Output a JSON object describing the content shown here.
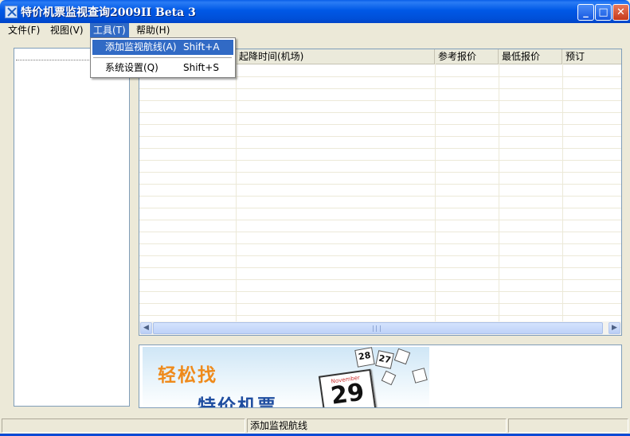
{
  "window": {
    "title": "特价机票监视查询2009II Beta 3",
    "controls": {
      "minimize": "_",
      "maximize": "□",
      "close": "✕"
    }
  },
  "menubar": {
    "items": [
      {
        "label": "文件(F)"
      },
      {
        "label": "视图(V)"
      },
      {
        "label": "工具(T)"
      },
      {
        "label": "帮助(H)"
      }
    ]
  },
  "tools_menu": {
    "items": [
      {
        "label": "添加监视航线(A)",
        "shortcut": "Shift+A"
      },
      {
        "label": "系统设置(Q)",
        "shortcut": "Shift+S"
      }
    ]
  },
  "grid": {
    "columns": [
      "",
      "起降时间(机场)",
      "参考报价",
      "最低报价",
      "预订"
    ],
    "rows": []
  },
  "ad_banner": {
    "line1": "轻松找",
    "line2": "特价机票",
    "calendar_month": "November",
    "calendar_day": "29",
    "small_calendars": [
      "28",
      "27"
    ]
  },
  "statusbar": {
    "panes": [
      "",
      "添加监视航线",
      ""
    ]
  },
  "colors": {
    "titlebar": "#0058e6",
    "menu_highlight": "#316ac5",
    "ad_orange": "#ef8a1b",
    "ad_blue": "#1f4da0"
  }
}
